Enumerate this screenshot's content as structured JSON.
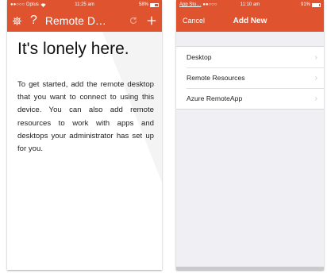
{
  "left_screen": {
    "status": {
      "carrier": "●●○○○ Optus",
      "time": "11:25 am",
      "battery": "58%",
      "battery_level": 0.58
    },
    "navbar": {
      "title": "Remote D…",
      "icons": [
        "gear-icon",
        "help-icon",
        "refresh-icon",
        "add-icon"
      ]
    },
    "heading": "It's lonely here.",
    "body": "To get started, add the remote desktop that you want to connect to using this device. You can also add remote resources to work with apps and desktops your administrator has set up for you."
  },
  "right_screen": {
    "status": {
      "back": "App Sto…",
      "signal": "●●○○○",
      "time": "11:10 am",
      "battery": "91%",
      "battery_level": 0.91
    },
    "navbar": {
      "cancel": "Cancel",
      "title": "Add New"
    },
    "items": [
      {
        "label": "Desktop"
      },
      {
        "label": "Remote Resources"
      },
      {
        "label": "Azure RemoteApp"
      }
    ]
  },
  "colors": {
    "accent": "#e0532f",
    "group_bg": "#efeff4"
  }
}
